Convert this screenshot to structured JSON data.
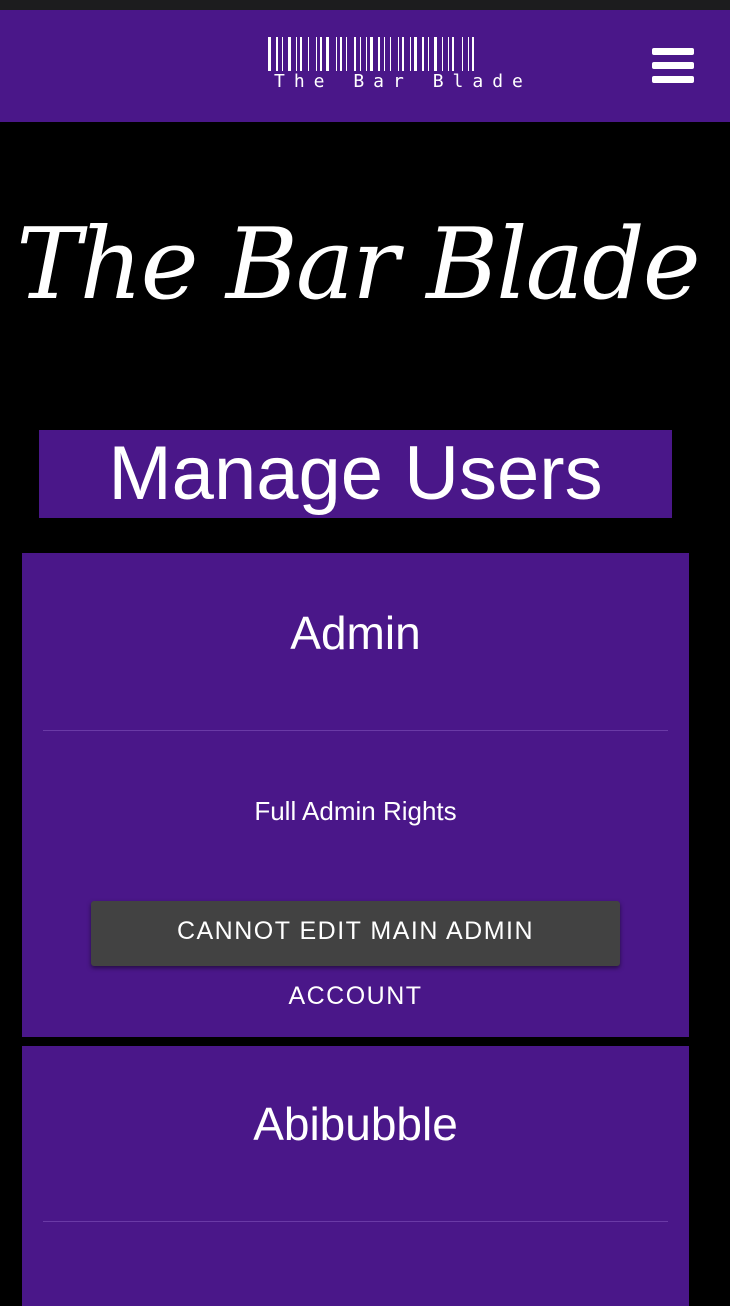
{
  "header": {
    "logo_text": "The Bar Blade",
    "menu_icon": "hamburger-menu-icon",
    "background": "#4a1789"
  },
  "hero": {
    "title": "The Bar Blade"
  },
  "page": {
    "heading": "Manage Users"
  },
  "users": [
    {
      "name": "Admin",
      "rights": "Full Admin Rights",
      "action_label_line1": "Cannot edit main admin",
      "action_label_line2": "account"
    },
    {
      "name": "Abibubble"
    }
  ],
  "colors": {
    "brand_purple": "#4a1789",
    "button_gray": "#424242",
    "page_background": "#000000"
  }
}
